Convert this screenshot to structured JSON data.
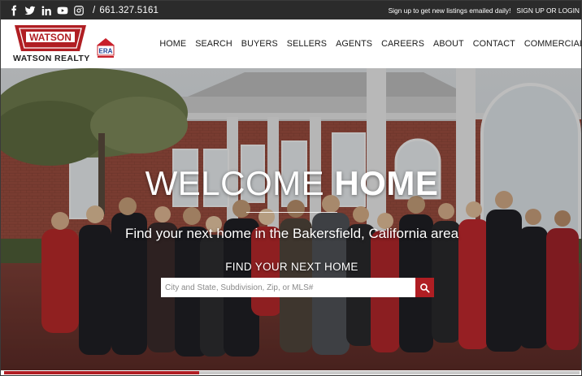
{
  "topbar": {
    "social_icons": [
      "facebook-icon",
      "twitter-icon",
      "linkedin-icon",
      "youtube-icon",
      "instagram-icon"
    ],
    "separator": "/",
    "phone": "661.327.5161",
    "signup_message": "Sign up to get new listings emailed daily!",
    "signup_link": "SIGN UP OR LOGIN"
  },
  "header": {
    "logo_badge_text": "WATSON",
    "logo_text": "WATSON REALTY",
    "era_text": "ERA",
    "nav": [
      "HOME",
      "SEARCH",
      "BUYERS",
      "SELLERS",
      "AGENTS",
      "CAREERS",
      "ABOUT",
      "CONTACT",
      "COMMERCIAL"
    ]
  },
  "hero": {
    "welcome_thin": "WELCOME",
    "welcome_bold": "HOME",
    "subtitle": "Find your next home in the Bakersfield, California area",
    "find_label": "FIND YOUR NEXT HOME",
    "search_placeholder": "City and State, Subdivision, Zip, or MLS#"
  },
  "colors": {
    "brand_red": "#b01e23",
    "topbar_bg": "#2b2b2b"
  }
}
